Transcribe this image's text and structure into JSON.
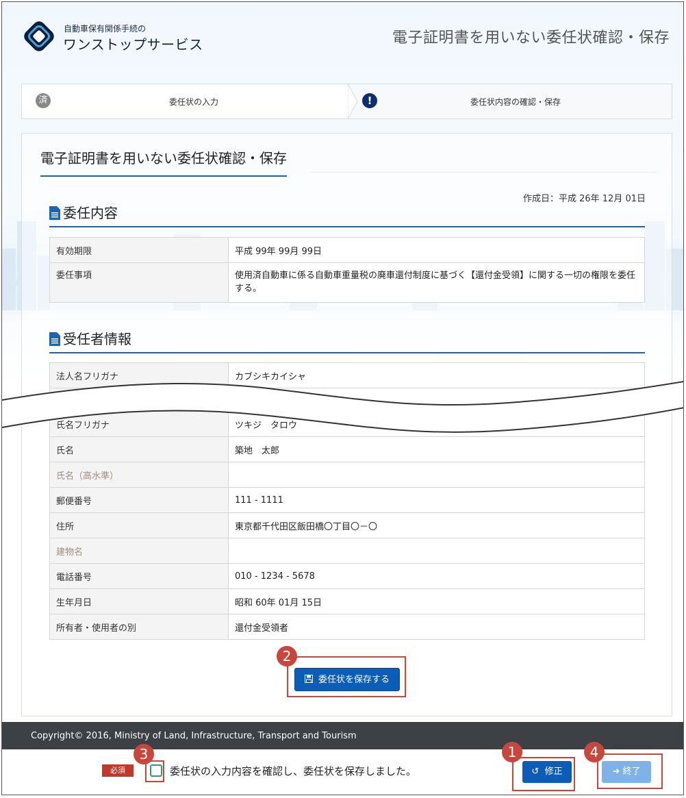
{
  "header": {
    "logo_sub": "自動車保有関係手続の",
    "logo_main": "ワンストップサービス",
    "page_heading": "電子証明書を用いない委任状確認・保存"
  },
  "stepper": {
    "step1": {
      "badge": "済",
      "label": "委任状の入力"
    },
    "step2": {
      "badge": "!",
      "label": "委任状内容の確認・保存"
    }
  },
  "panel": {
    "title": "電子証明書を用いない委任状確認・保存",
    "created_date": "作成日：平成 26年 12月 01日"
  },
  "delegation": {
    "heading": "委任内容",
    "rows": [
      {
        "key": "有効期限",
        "value": "平成 99年 99月 99日"
      },
      {
        "key": "委任事項",
        "value": "使用済自動車に係る自動車重量税の廃車還付制度に基づく【還付金受領】に関する一切の権限を委任する。"
      }
    ]
  },
  "delegate": {
    "heading": "受任者情報",
    "rows_top": [
      {
        "key": "法人名フリガナ",
        "value": "カブシキカイシャ"
      },
      {
        "key": "氏名フリガナ",
        "value": "ツキジ　タロウ"
      }
    ],
    "rows": [
      {
        "key": "氏名",
        "value": "築地　太郎"
      },
      {
        "key": "氏名（高水準）",
        "value": ""
      },
      {
        "key": "郵便番号",
        "value": "111 - 1111"
      },
      {
        "key": "住所",
        "value": "東京都千代田区飯田橋〇丁目〇－〇"
      },
      {
        "key": "建物名",
        "value": ""
      },
      {
        "key": "電話番号",
        "value": "010 - 1234 - 5678"
      },
      {
        "key": "生年月日",
        "value": "昭和 60年 01月 15日"
      },
      {
        "key": "所有者・使用者の別",
        "value": "還付金受領者"
      }
    ]
  },
  "save_button": "委任状を保存する",
  "footer": {
    "copyright": "Copyright© 2016, Ministry of Land, Infrastructure, Transport and Tourism"
  },
  "bottom": {
    "required": "必須",
    "confirm_label": "委任状の入力内容を確認し、委任状を保存しました。",
    "fix_button": "修正",
    "end_button": "終了"
  },
  "markers": [
    "1",
    "2",
    "3",
    "4"
  ],
  "colors": {
    "accent": "#1a63b5",
    "button": "#0c5db8",
    "button_disabled": "#7fb2e8",
    "marker": "#c9463d",
    "footer": "#3d4145"
  }
}
